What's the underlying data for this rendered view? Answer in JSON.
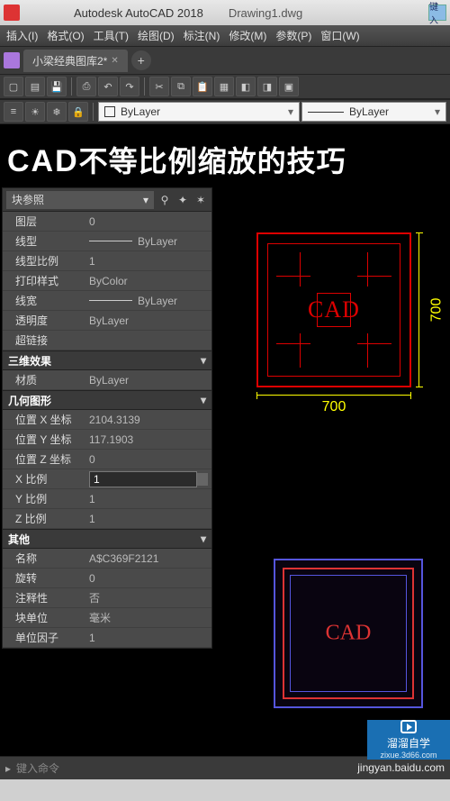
{
  "titlebar": {
    "app": "Autodesk AutoCAD 2018",
    "file": "Drawing1.dwg",
    "search_hint": "键入"
  },
  "menu": {
    "items": [
      "插入(I)",
      "格式(O)",
      "工具(T)",
      "绘图(D)",
      "标注(N)",
      "修改(M)",
      "参数(P)",
      "窗口(W)"
    ]
  },
  "doctab": {
    "name": "小梁经典图库2*",
    "add": "+"
  },
  "layers": {
    "current": "ByLayer",
    "linetype": "ByLayer"
  },
  "headline": {
    "cad": "CAD",
    "rest": "不等比例缩放的技巧"
  },
  "props": {
    "selector": "块参照",
    "rows_general": [
      {
        "label": "图层",
        "value": "0"
      },
      {
        "label": "线型",
        "value": "ByLayer",
        "line": true
      },
      {
        "label": "线型比例",
        "value": "1"
      },
      {
        "label": "打印样式",
        "value": "ByColor"
      },
      {
        "label": "线宽",
        "value": "ByLayer",
        "line": true
      },
      {
        "label": "透明度",
        "value": "ByLayer"
      },
      {
        "label": "超链接",
        "value": ""
      }
    ],
    "section_3d": "三维效果",
    "rows_3d": [
      {
        "label": "材质",
        "value": "ByLayer"
      }
    ],
    "section_geom": "几何图形",
    "rows_geom": [
      {
        "label": "位置 X 坐标",
        "value": "2104.3139"
      },
      {
        "label": "位置 Y 坐标",
        "value": "117.1903"
      },
      {
        "label": "位置 Z 坐标",
        "value": "0"
      },
      {
        "label": "X 比例",
        "value": "1",
        "editable": true
      },
      {
        "label": "Y 比例",
        "value": "1"
      },
      {
        "label": "Z 比例",
        "value": "1"
      }
    ],
    "section_misc": "其他",
    "rows_misc": [
      {
        "label": "名称",
        "value": "A$C369F2121"
      },
      {
        "label": "旋转",
        "value": "0"
      },
      {
        "label": "注释性",
        "value": "否"
      },
      {
        "label": "块单位",
        "value": "毫米"
      },
      {
        "label": "单位因子",
        "value": "1"
      }
    ]
  },
  "drawing": {
    "cad_label": "CAD",
    "dim_w": "700",
    "dim_h": "700"
  },
  "cmdline": {
    "prompt": "键入命令"
  },
  "brand": {
    "name": "溜溜自学",
    "url": "zixue.3d66.com"
  },
  "watermark": "jingyan.baidu.com"
}
